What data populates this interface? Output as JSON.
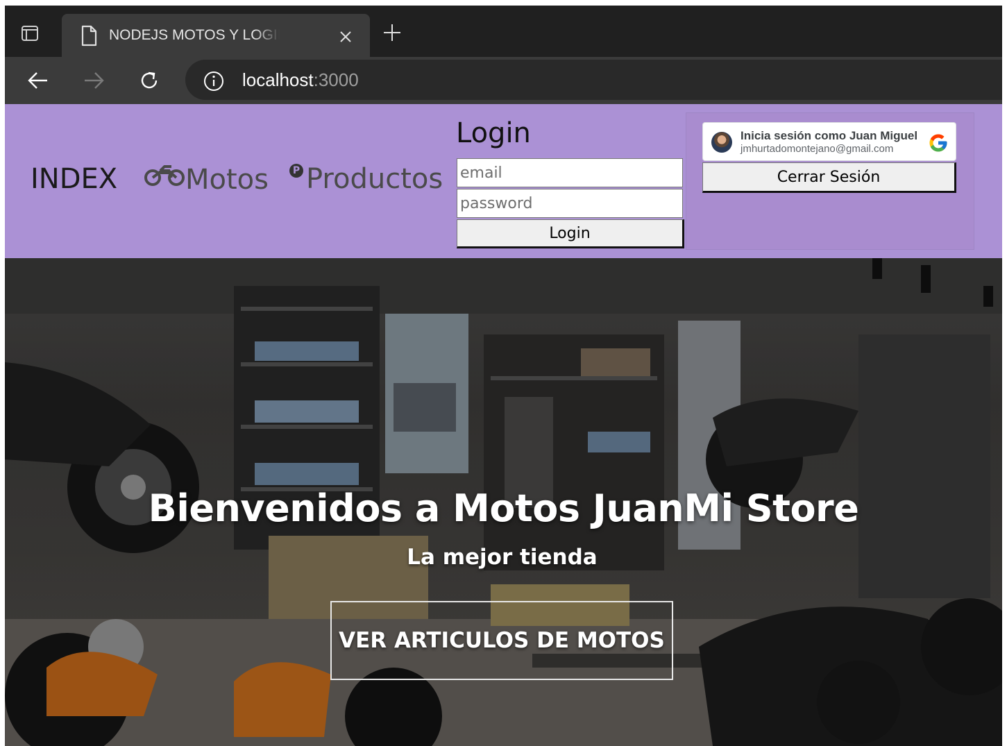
{
  "browser": {
    "tab_title": "NODEJS MOTOS Y LOGIN DE GOOGLE",
    "url_host": "localhost",
    "url_port": ":3000"
  },
  "nav": {
    "index": "INDEX",
    "motos": "Motos",
    "productos": "Productos",
    "productos_badge": "P"
  },
  "login": {
    "title": "Login",
    "email_placeholder": "email",
    "password_placeholder": "password",
    "button": "Login"
  },
  "google": {
    "signin_text": "Inicia sesión como Juan Miguel",
    "email": "jmhurtadomontejano@gmail.com",
    "logout": "Cerrar Sesión"
  },
  "hero": {
    "title": "Bienvenidos a Motos JuanMi Store",
    "subtitle": "La mejor tienda",
    "button": "VER ARTICULOS DE MOTOS"
  },
  "colors": {
    "navbar": "#ab91d5",
    "chrome_dark": "#202020",
    "chrome_tab": "#3b3b3b"
  }
}
